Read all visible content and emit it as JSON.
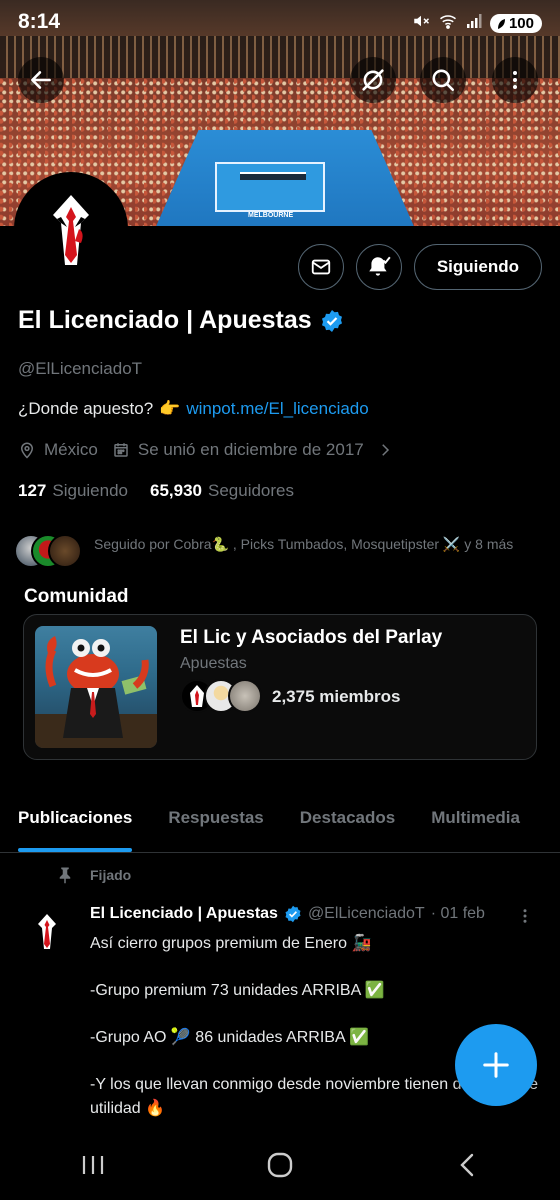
{
  "status_bar": {
    "time": "8:14",
    "battery": "100"
  },
  "profile": {
    "name": "El Licenciado | Apuestas",
    "handle": "@ElLicenciadoT",
    "bio_text": "¿Donde apuesto?",
    "bio_link": "winpot.me/El_licenciado",
    "location": "México",
    "joined": "Se unió en diciembre de 2017",
    "following_count": "127",
    "following_label": "Siguiendo",
    "followers_count": "65,930",
    "followers_label": "Seguidores",
    "follow_button": "Siguiendo",
    "banner_word": "MELBOURNE"
  },
  "followed_by": {
    "text": "Seguido por Cobra🐍 , Picks Tumbados, Mosquetipster ⚔️ y 8 más"
  },
  "community": {
    "heading": "Comunidad",
    "title": "El Lic y Asociados del Parlay",
    "category": "Apuestas",
    "members": "2,375 miembros"
  },
  "tabs": [
    {
      "label": "Publicaciones",
      "active": true
    },
    {
      "label": "Respuestas",
      "active": false
    },
    {
      "label": "Destacados",
      "active": false
    },
    {
      "label": "Multimedia",
      "active": false
    }
  ],
  "pinned_tweet": {
    "pinned_label": "Fijado",
    "author": "El Licenciado | Apuestas",
    "handle": "@ElLicenciadoT",
    "date": "· 01 feb",
    "lines": [
      "Así cierro grupos premium de Enero 🚂",
      "",
      "-Grupo premium 73 unidades ARRIBA ✅",
      "",
      "-Grupo AO 🎾 86 unidades ARRIBA ✅",
      "",
      "-Y los que llevan conmigo desde noviembre tienen de 200% de utilidad 🔥"
    ]
  },
  "colors": {
    "accent": "#1d9bf0",
    "background": "#000000",
    "muted": "#71767b"
  },
  "icons": [
    "back-arrow-icon",
    "grok-icon",
    "search-icon",
    "more-vert-icon",
    "mail-icon",
    "bell-check-icon",
    "verified-icon",
    "location-icon",
    "calendar-icon",
    "chevron-right-icon",
    "pin-icon",
    "plus-icon"
  ]
}
